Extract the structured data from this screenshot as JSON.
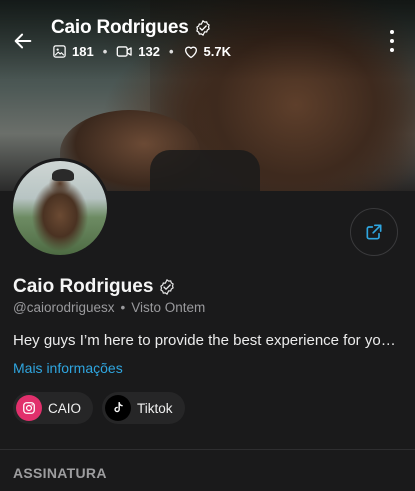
{
  "header": {
    "name": "Caio Rodrigues",
    "stats": {
      "photos": "181",
      "videos": "132",
      "likes": "5.7K"
    }
  },
  "profile": {
    "name": "Caio Rodrigues",
    "handle": "@caiorodriguesx",
    "separator": "•",
    "last_seen": "Visto  Ontem",
    "bio": "Hey guys I’m here to provide the best experience for you. If you want the best content...",
    "more_info": "Mais informações"
  },
  "socials": [
    {
      "label": "CAIO",
      "icon": "instagram-icon",
      "color": "#e1306c"
    },
    {
      "label": "Tiktok",
      "icon": "tiktok-icon",
      "color": "#000000"
    }
  ],
  "section": {
    "title": "ASSINATURA"
  },
  "colors": {
    "background": "#1a1a1b",
    "link": "#2fa6e0",
    "instagram": "#e1306c"
  }
}
